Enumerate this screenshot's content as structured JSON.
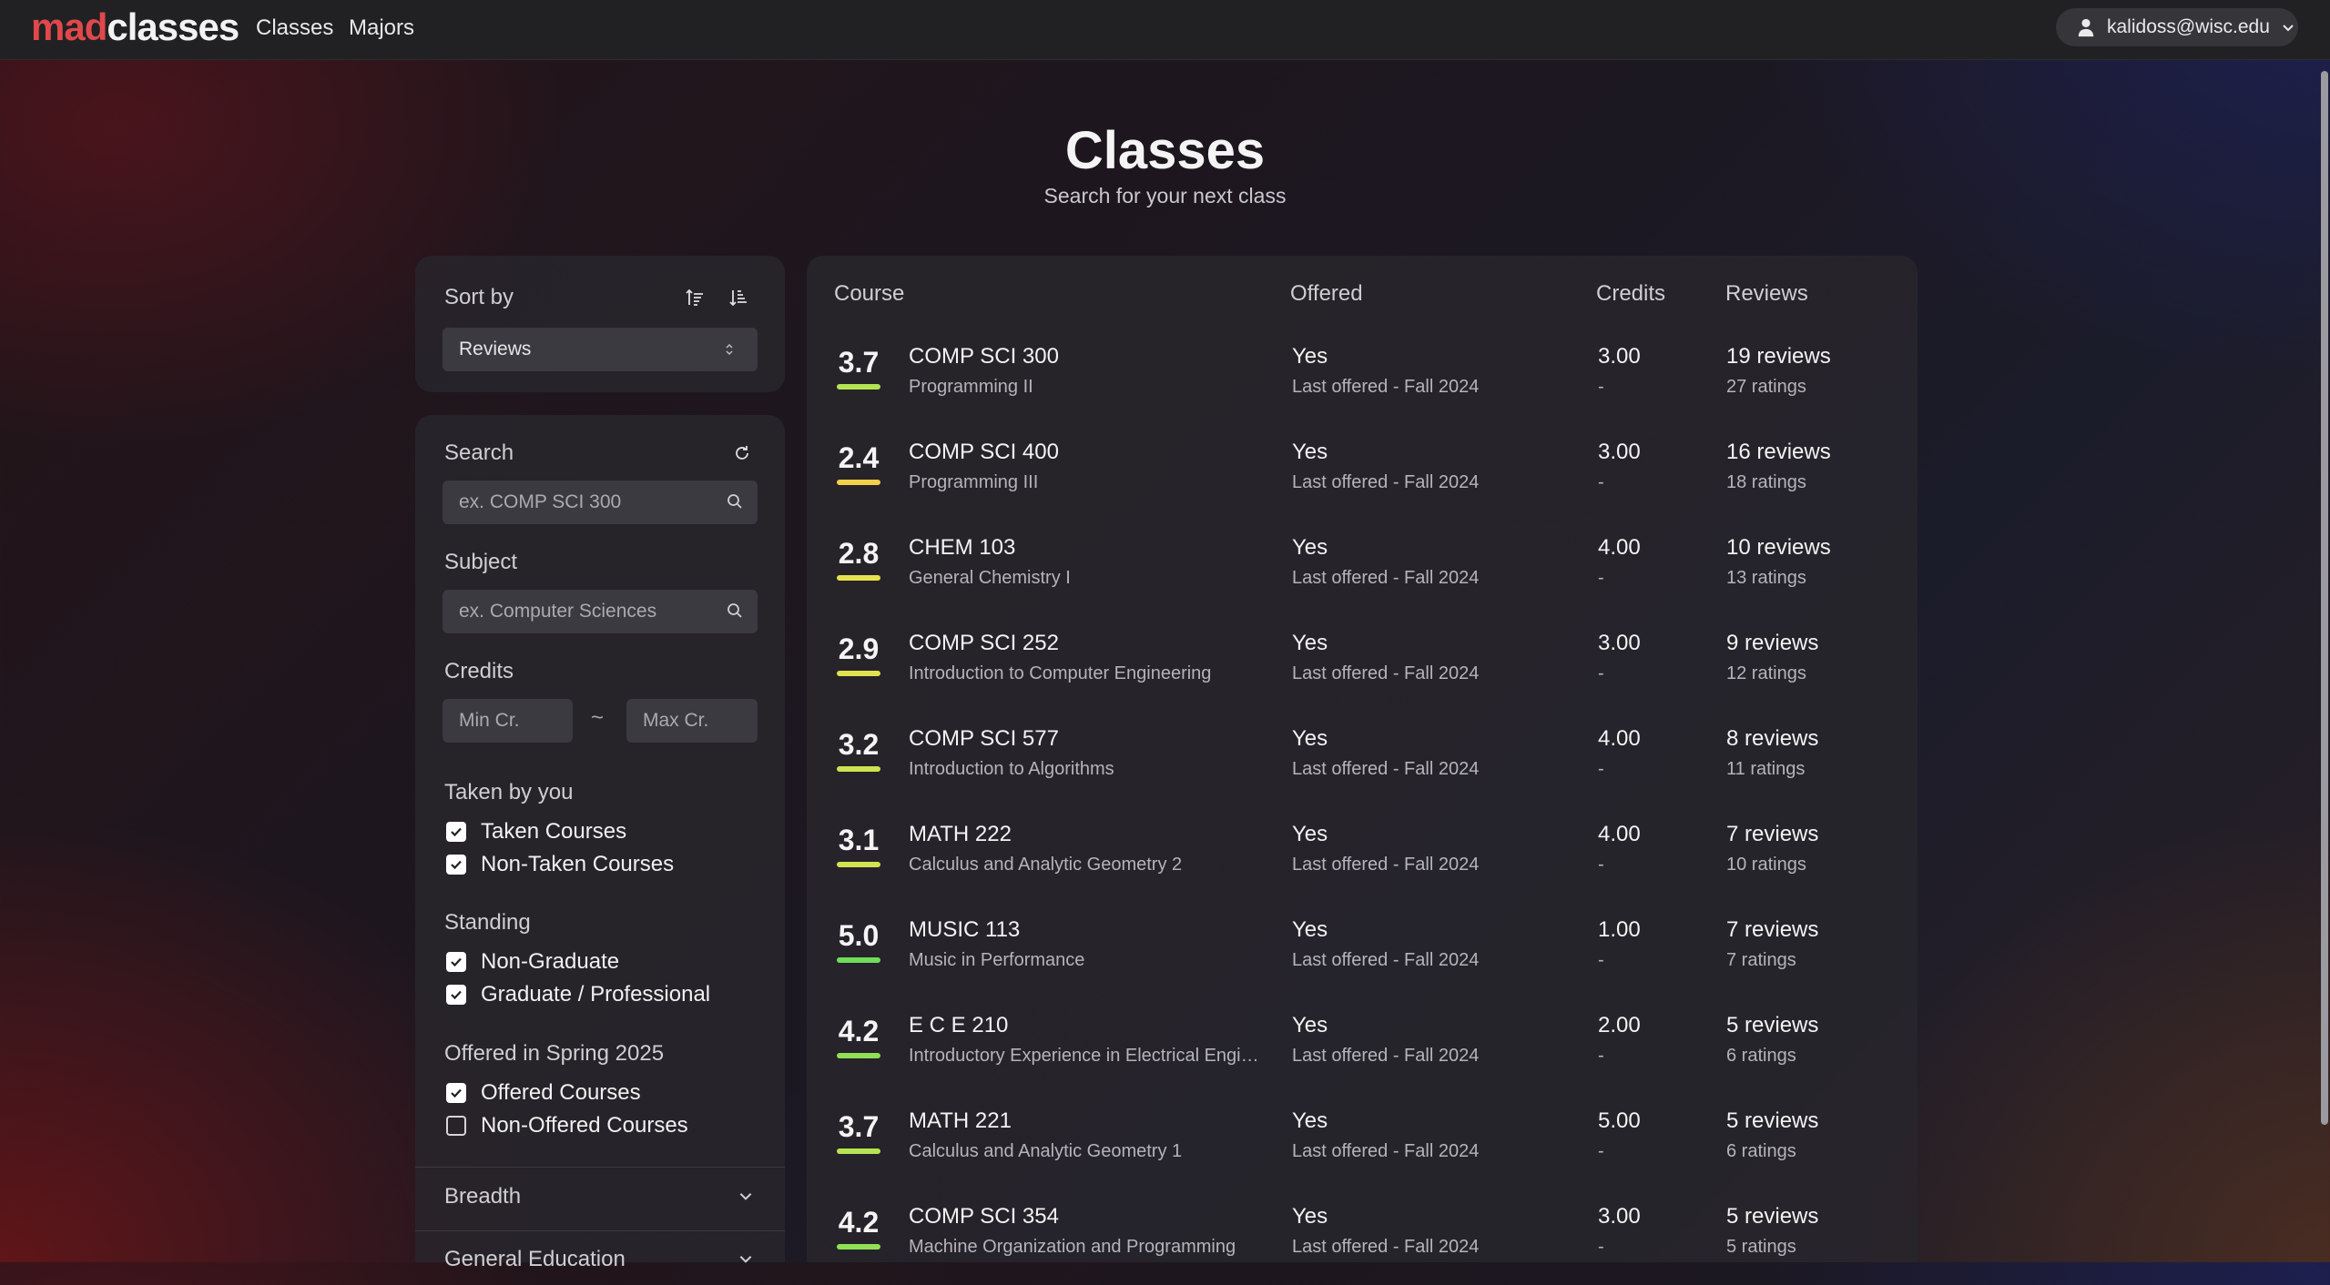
{
  "topbar": {
    "logo_mad": "mad",
    "logo_classes": "classes",
    "nav": [
      "Classes",
      "Majors"
    ],
    "user_email": "kalidoss@wisc.edu"
  },
  "header": {
    "title": "Classes",
    "subtitle": "Search for your next class"
  },
  "sort": {
    "label": "Sort by",
    "selected": "Reviews"
  },
  "filters": {
    "search_label": "Search",
    "search_placeholder": "ex. COMP SCI 300",
    "subject_label": "Subject",
    "subject_placeholder": "ex. Computer Sciences",
    "credits_label": "Credits",
    "min_placeholder": "Min Cr.",
    "range_sep": "~",
    "max_placeholder": "Max Cr.",
    "taken_label": "Taken by you",
    "taken_options": [
      {
        "label": "Taken Courses",
        "checked": true
      },
      {
        "label": "Non-Taken Courses",
        "checked": true
      }
    ],
    "standing_label": "Standing",
    "standing_options": [
      {
        "label": "Non-Graduate",
        "checked": true
      },
      {
        "label": "Graduate / Professional",
        "checked": true
      }
    ],
    "offered_label": "Offered in Spring 2025",
    "offered_options": [
      {
        "label": "Offered Courses",
        "checked": true
      },
      {
        "label": "Non-Offered Courses",
        "checked": false
      }
    ],
    "breadth_label": "Breadth",
    "gened_label": "General Education"
  },
  "table": {
    "headers": {
      "course": "Course",
      "offered": "Offered",
      "credits": "Credits",
      "reviews": "Reviews"
    },
    "rows": [
      {
        "score": "3.7",
        "bar_color": "#b5e353",
        "course": "COMP SCI 300",
        "title": "Programming II",
        "offered": "Yes",
        "last": "Last offered - Fall 2024",
        "credits": "3.00",
        "credits_sub": "-",
        "reviews": "19 reviews",
        "ratings": "27 ratings"
      },
      {
        "score": "2.4",
        "bar_color": "#f2d04a",
        "course": "COMP SCI 400",
        "title": "Programming III",
        "offered": "Yes",
        "last": "Last offered - Fall 2024",
        "credits": "3.00",
        "credits_sub": "-",
        "reviews": "16 reviews",
        "ratings": "18 ratings"
      },
      {
        "score": "2.8",
        "bar_color": "#e6e24e",
        "course": "CHEM 103",
        "title": "General Chemistry I",
        "offered": "Yes",
        "last": "Last offered - Fall 2024",
        "credits": "4.00",
        "credits_sub": "-",
        "reviews": "10 reviews",
        "ratings": "13 ratings"
      },
      {
        "score": "2.9",
        "bar_color": "#e0e24f",
        "course": "COMP SCI 252",
        "title": "Introduction to Computer Engineering",
        "offered": "Yes",
        "last": "Last offered - Fall 2024",
        "credits": "3.00",
        "credits_sub": "-",
        "reviews": "9 reviews",
        "ratings": "12 ratings"
      },
      {
        "score": "3.2",
        "bar_color": "#cde351",
        "course": "COMP SCI 577",
        "title": "Introduction to Algorithms",
        "offered": "Yes",
        "last": "Last offered - Fall 2024",
        "credits": "4.00",
        "credits_sub": "-",
        "reviews": "8 reviews",
        "ratings": "11 ratings"
      },
      {
        "score": "3.1",
        "bar_color": "#d2e351",
        "course": "MATH 222",
        "title": "Calculus and Analytic Geometry 2",
        "offered": "Yes",
        "last": "Last offered - Fall 2024",
        "credits": "4.00",
        "credits_sub": "-",
        "reviews": "7 reviews",
        "ratings": "10 ratings"
      },
      {
        "score": "5.0",
        "bar_color": "#6fdc5a",
        "course": "MUSIC 113",
        "title": "Music in Performance",
        "offered": "Yes",
        "last": "Last offered - Fall 2024",
        "credits": "1.00",
        "credits_sub": "-",
        "reviews": "7 reviews",
        "ratings": "7 ratings"
      },
      {
        "score": "4.2",
        "bar_color": "#8fe055",
        "course": "E C E 210",
        "title": "Introductory Experience in Electrical Engineering",
        "offered": "Yes",
        "last": "Last offered - Fall 2024",
        "credits": "2.00",
        "credits_sub": "-",
        "reviews": "5 reviews",
        "ratings": "6 ratings"
      },
      {
        "score": "3.7",
        "bar_color": "#b5e353",
        "course": "MATH 221",
        "title": "Calculus and Analytic Geometry 1",
        "offered": "Yes",
        "last": "Last offered - Fall 2024",
        "credits": "5.00",
        "credits_sub": "-",
        "reviews": "5 reviews",
        "ratings": "6 ratings"
      },
      {
        "score": "4.2",
        "bar_color": "#8fe055",
        "course": "COMP SCI 354",
        "title": "Machine Organization and Programming",
        "offered": "Yes",
        "last": "Last offered - Fall 2024",
        "credits": "3.00",
        "credits_sub": "-",
        "reviews": "5 reviews",
        "ratings": "5 ratings"
      }
    ]
  }
}
